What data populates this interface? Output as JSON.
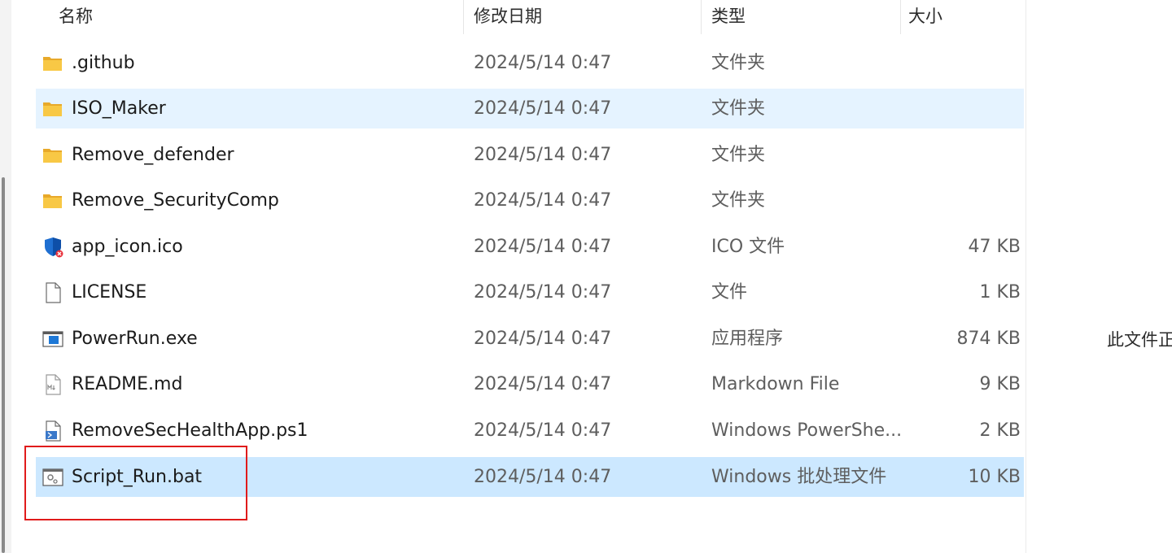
{
  "columns": {
    "name": "名称",
    "date": "修改日期",
    "type": "类型",
    "size": "大小"
  },
  "files": [
    {
      "name": ".github",
      "date": "2024/5/14 0:47",
      "type": "文件夹",
      "size": "",
      "icon": "folder-icon",
      "state": "normal"
    },
    {
      "name": "ISO_Maker",
      "date": "2024/5/14 0:47",
      "type": "文件夹",
      "size": "",
      "icon": "folder-icon",
      "state": "hover"
    },
    {
      "name": "Remove_defender",
      "date": "2024/5/14 0:47",
      "type": "文件夹",
      "size": "",
      "icon": "folder-icon",
      "state": "normal"
    },
    {
      "name": "Remove_SecurityComp",
      "date": "2024/5/14 0:47",
      "type": "文件夹",
      "size": "",
      "icon": "folder-icon",
      "state": "normal"
    },
    {
      "name": "app_icon.ico",
      "date": "2024/5/14 0:47",
      "type": "ICO 文件",
      "size": "47 KB",
      "icon": "shield-icon",
      "state": "normal"
    },
    {
      "name": "LICENSE",
      "date": "2024/5/14 0:47",
      "type": "文件",
      "size": "1 KB",
      "icon": "blank-file-icon",
      "state": "normal"
    },
    {
      "name": "PowerRun.exe",
      "date": "2024/5/14 0:47",
      "type": "应用程序",
      "size": "874 KB",
      "icon": "exe-icon",
      "state": "normal"
    },
    {
      "name": "README.md",
      "date": "2024/5/14 0:47",
      "type": "Markdown File",
      "size": "9 KB",
      "icon": "markdown-file-icon",
      "state": "normal"
    },
    {
      "name": "RemoveSecHealthApp.ps1",
      "date": "2024/5/14 0:47",
      "type": "Windows PowerShe...",
      "size": "2 KB",
      "icon": "powershell-file-icon",
      "state": "normal"
    },
    {
      "name": "Script_Run.bat",
      "date": "2024/5/14 0:47",
      "type": "Windows 批处理文件",
      "size": "10 KB",
      "icon": "batch-file-icon",
      "state": "selected"
    }
  ],
  "preview_pane_text": "此文件正",
  "colors": {
    "selected_row": "#cce8ff",
    "hover_row": "#e5f3ff",
    "highlight_box": "#e01b1b",
    "folder": "#f8c845"
  }
}
